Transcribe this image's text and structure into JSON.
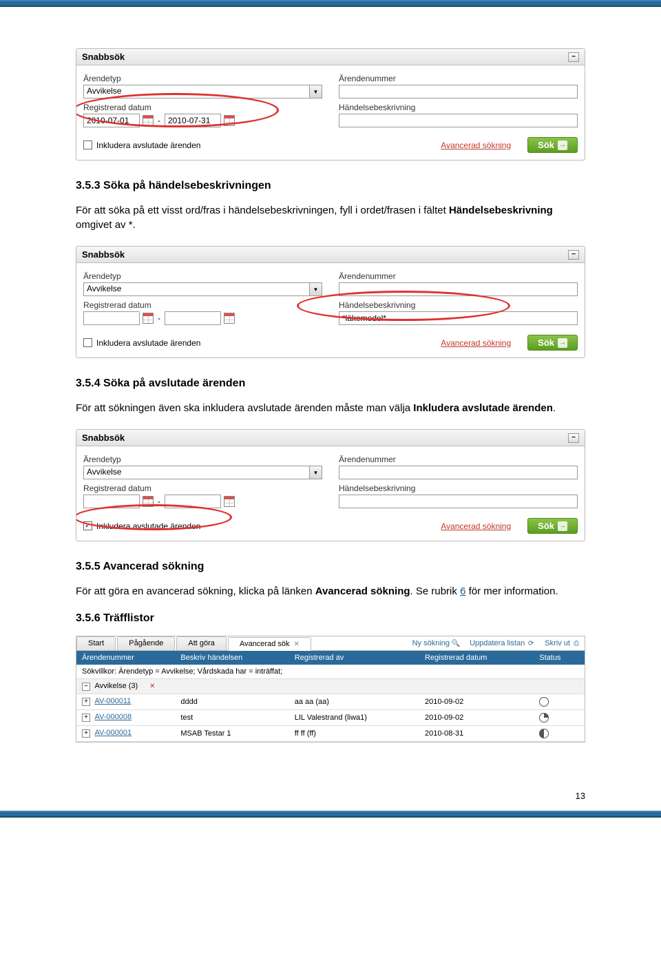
{
  "sections": {
    "s353": {
      "heading": "3.5.3 Söka på händelsebeskrivningen",
      "text_plain": "För att söka på ett visst ord/fras i händelsebeskrivningen, fyll i ordet/frasen i fältet Händelsebeskrivning omgivet av *."
    },
    "s354": {
      "heading": "3.5.4 Söka på avslutade ärenden",
      "text_plain": "För att sökningen även ska inkludera avslutade ärenden måste man välja Inkludera avslutade ärenden."
    },
    "s355": {
      "heading": "3.5.5 Avancerad sökning",
      "text_plain": "För att göra en avancerad sökning, klicka på länken Avancerad sökning. Se rubrik 6 för mer information."
    },
    "s356": {
      "heading": "3.5.6 Träfflistor"
    }
  },
  "panel": {
    "title": "Snabbsök",
    "arendetyp_label": "Ärendetyp",
    "arendetyp_value": "Avvikelse",
    "arendenummer_label": "Ärendenummer",
    "regdate_label": "Registrerad datum",
    "hbesk_label": "Händelsebeskrivning",
    "inkludera_label": "Inkludera avslutade ärenden",
    "adv_link": "Avancerad sökning",
    "sok_label": "Sök",
    "collapse": "−"
  },
  "panel1": {
    "date_from": "2010-07-01",
    "date_to": "2010-07-31",
    "hbesk_value": "",
    "chk_checked": ""
  },
  "panel2": {
    "date_from": "",
    "date_to": "",
    "hbesk_value": "*läkemedel*",
    "chk_checked": ""
  },
  "panel3": {
    "date_from": "",
    "date_to": "",
    "hbesk_value": "",
    "chk_checked": "✓"
  },
  "results": {
    "tabs": {
      "start": "Start",
      "pagaende": "Pågående",
      "attgora": "Att göra",
      "advsok": "Avancerad sök"
    },
    "toolbar": {
      "nysokning": "Ny sökning",
      "uppdatera": "Uppdatera listan",
      "skrivut": "Skriv ut"
    },
    "columns": {
      "arendenr": "Ärendenummer",
      "beskriv": "Beskriv händelsen",
      "regav": "Registrerad av",
      "regdate": "Registrerad datum",
      "status": "Status"
    },
    "sokvillkor": "Sökvillkor: Ärendetyp = Avvikelse; Vårdskada har = inträffat;",
    "group": "Avvikelse (3)",
    "rows": [
      {
        "nr": "AV-000011",
        "besk": "dddd",
        "av": "aa aa (aa)",
        "date": "2010-09-02",
        "status": "empty"
      },
      {
        "nr": "AV-000008",
        "besk": "test",
        "av": "LIL Valestrand (liwa1)",
        "date": "2010-09-02",
        "status": "q"
      },
      {
        "nr": "AV-000001",
        "besk": "MSAB Testar 1",
        "av": "ff ff (ff)",
        "date": "2010-08-31",
        "status": "half"
      }
    ]
  },
  "page_number": "13"
}
